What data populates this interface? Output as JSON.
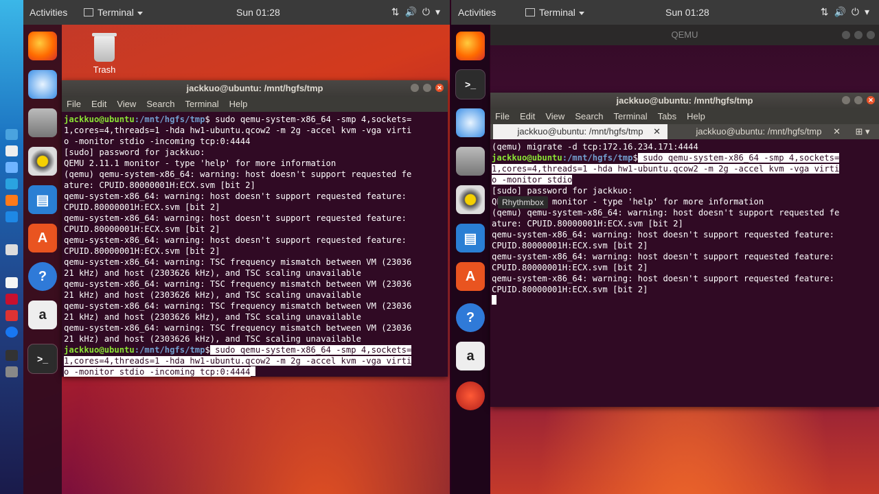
{
  "topbar_left": {
    "activities": "Activities",
    "app_menu": "Terminal",
    "clock": "Sun 01:28"
  },
  "topbar_right": {
    "activities": "Activities",
    "app_menu": "Terminal",
    "clock": "Sun 01:28"
  },
  "desktop": {
    "trash_label": "Trash"
  },
  "qemu_window": {
    "title": "QEMU"
  },
  "tooltip": "Rhythmbox",
  "left_terminal": {
    "title": "jackkuo@ubuntu: /mnt/hgfs/tmp",
    "menu": [
      "File",
      "Edit",
      "View",
      "Search",
      "Terminal",
      "Help"
    ],
    "prompt_user": "jackkuo@ubuntu",
    "prompt_path": ":/mnt/hgfs/tmp",
    "prompt_sym": "$",
    "cmd1": [
      " sudo qemu-system-x86_64 -smp 4,sockets=",
      "1,cores=4,threads=1 -hda hw1-ubuntu.qcow2 -m 2g -accel kvm -vga virti",
      "o -monitor stdio -incoming tcp:0:4444"
    ],
    "output": [
      "[sudo] password for jackkuo:",
      "QEMU 2.11.1 monitor - type 'help' for more information",
      "(qemu) qemu-system-x86_64: warning: host doesn't support requested fe",
      "ature: CPUID.80000001H:ECX.svm [bit 2]",
      "qemu-system-x86_64: warning: host doesn't support requested feature:",
      "CPUID.80000001H:ECX.svm [bit 2]",
      "qemu-system-x86_64: warning: host doesn't support requested feature:",
      "CPUID.80000001H:ECX.svm [bit 2]",
      "qemu-system-x86_64: warning: host doesn't support requested feature:",
      "CPUID.80000001H:ECX.svm [bit 2]",
      "qemu-system-x86_64: warning: TSC frequency mismatch between VM (23036",
      "21 kHz) and host (2303626 kHz), and TSC scaling unavailable",
      "qemu-system-x86_64: warning: TSC frequency mismatch between VM (23036",
      "21 kHz) and host (2303626 kHz), and TSC scaling unavailable",
      "qemu-system-x86_64: warning: TSC frequency mismatch between VM (23036",
      "21 kHz) and host (2303626 kHz), and TSC scaling unavailable",
      "qemu-system-x86_64: warning: TSC frequency mismatch between VM (23036",
      "21 kHz) and host (2303626 kHz), and TSC scaling unavailable"
    ],
    "cmd2": [
      " sudo qemu-system-x86_64 -smp 4,sockets=",
      "1,cores=4,threads=1 -hda hw1-ubuntu.qcow2 -m 2g -accel kvm -vga virti",
      "o -monitor stdio -incoming tcp:0:4444"
    ]
  },
  "right_terminal": {
    "title": "jackkuo@ubuntu: /mnt/hgfs/tmp",
    "menu": [
      "File",
      "Edit",
      "View",
      "Search",
      "Terminal",
      "Tabs",
      "Help"
    ],
    "tabs": [
      "jackkuo@ubuntu: /mnt/hgfs/tmp",
      "jackkuo@ubuntu: /mnt/hgfs/tmp"
    ],
    "first_line": "(qemu) migrate -d tcp:172.16.234.171:4444",
    "prompt_user": "jackkuo@ubuntu",
    "prompt_path": ":/mnt/hgfs/tmp",
    "prompt_sym": "$",
    "cmd": [
      " sudo qemu-system-x86_64 -smp 4,sockets=",
      "1,cores=4,threads=1 -hda hw1-ubuntu.qcow2 -m 2g -accel kvm -vga virti",
      "o -monitor stdio"
    ],
    "output": [
      "[sudo] password for jackkuo:",
      "QEMU 2.11.1 monitor - type 'help' for more information",
      "(qemu) qemu-system-x86_64: warning: host doesn't support requested fe",
      "ature: CPUID.80000001H:ECX.svm [bit 2]",
      "qemu-system-x86_64: warning: host doesn't support requested feature:",
      "CPUID.80000001H:ECX.svm [bit 2]",
      "qemu-system-x86_64: warning: host doesn't support requested feature:",
      "CPUID.80000001H:ECX.svm [bit 2]",
      "qemu-system-x86_64: warning: host doesn't support requested feature:",
      "CPUID.80000001H:ECX.svm [bit 2]"
    ]
  }
}
